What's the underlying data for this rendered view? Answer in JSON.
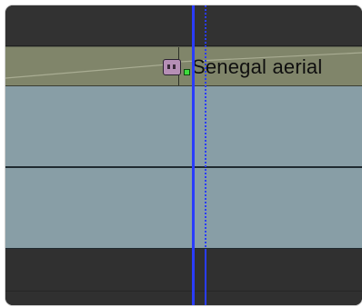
{
  "timeline": {
    "audio_clip": {
      "title": "Senegal aerial",
      "icon": "audio-clip-icon",
      "keyframe_color": "#3ddc3d"
    },
    "colors": {
      "audio_track": "#80856a",
      "video_track": "#889ea6",
      "background": "#2f2f2f",
      "playhead": "#2a3cff"
    }
  }
}
